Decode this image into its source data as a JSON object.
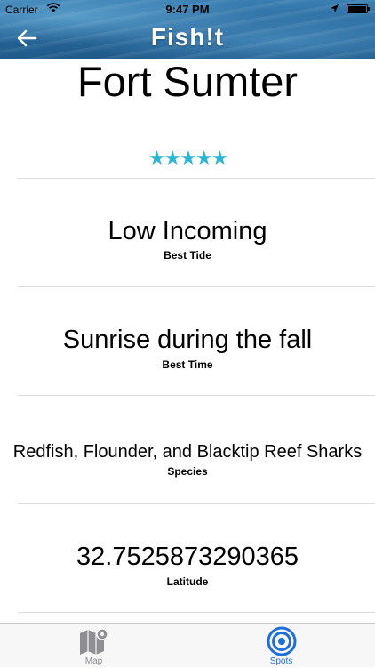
{
  "status_bar": {
    "carrier": "Carrier",
    "time": "9:47 PM"
  },
  "header": {
    "logo": "Fish!t",
    "back_icon": "back-arrow-icon"
  },
  "spot": {
    "name": "Fort Sumter",
    "rating": 5,
    "rating_max": 5,
    "rating_glyphs": "★★★★★",
    "fields": [
      {
        "value": "Low Incoming",
        "label": "Best Tide"
      },
      {
        "value": "Sunrise during the fall",
        "label": "Best Time"
      },
      {
        "value": "Redfish, Flounder, and Blacktip Reef Sharks",
        "label": "Species"
      },
      {
        "value": "32.7525873290365",
        "label": "Latitude"
      }
    ]
  },
  "tabbar": {
    "tabs": [
      {
        "label": "Map",
        "icon": "map-icon",
        "selected": false
      },
      {
        "label": "Spots",
        "icon": "target-icon",
        "selected": true
      }
    ]
  },
  "colors": {
    "accent_stars": "#2bb6d3",
    "tab_selected": "#1e6fd9",
    "tab_unselected": "#8e8e93"
  }
}
